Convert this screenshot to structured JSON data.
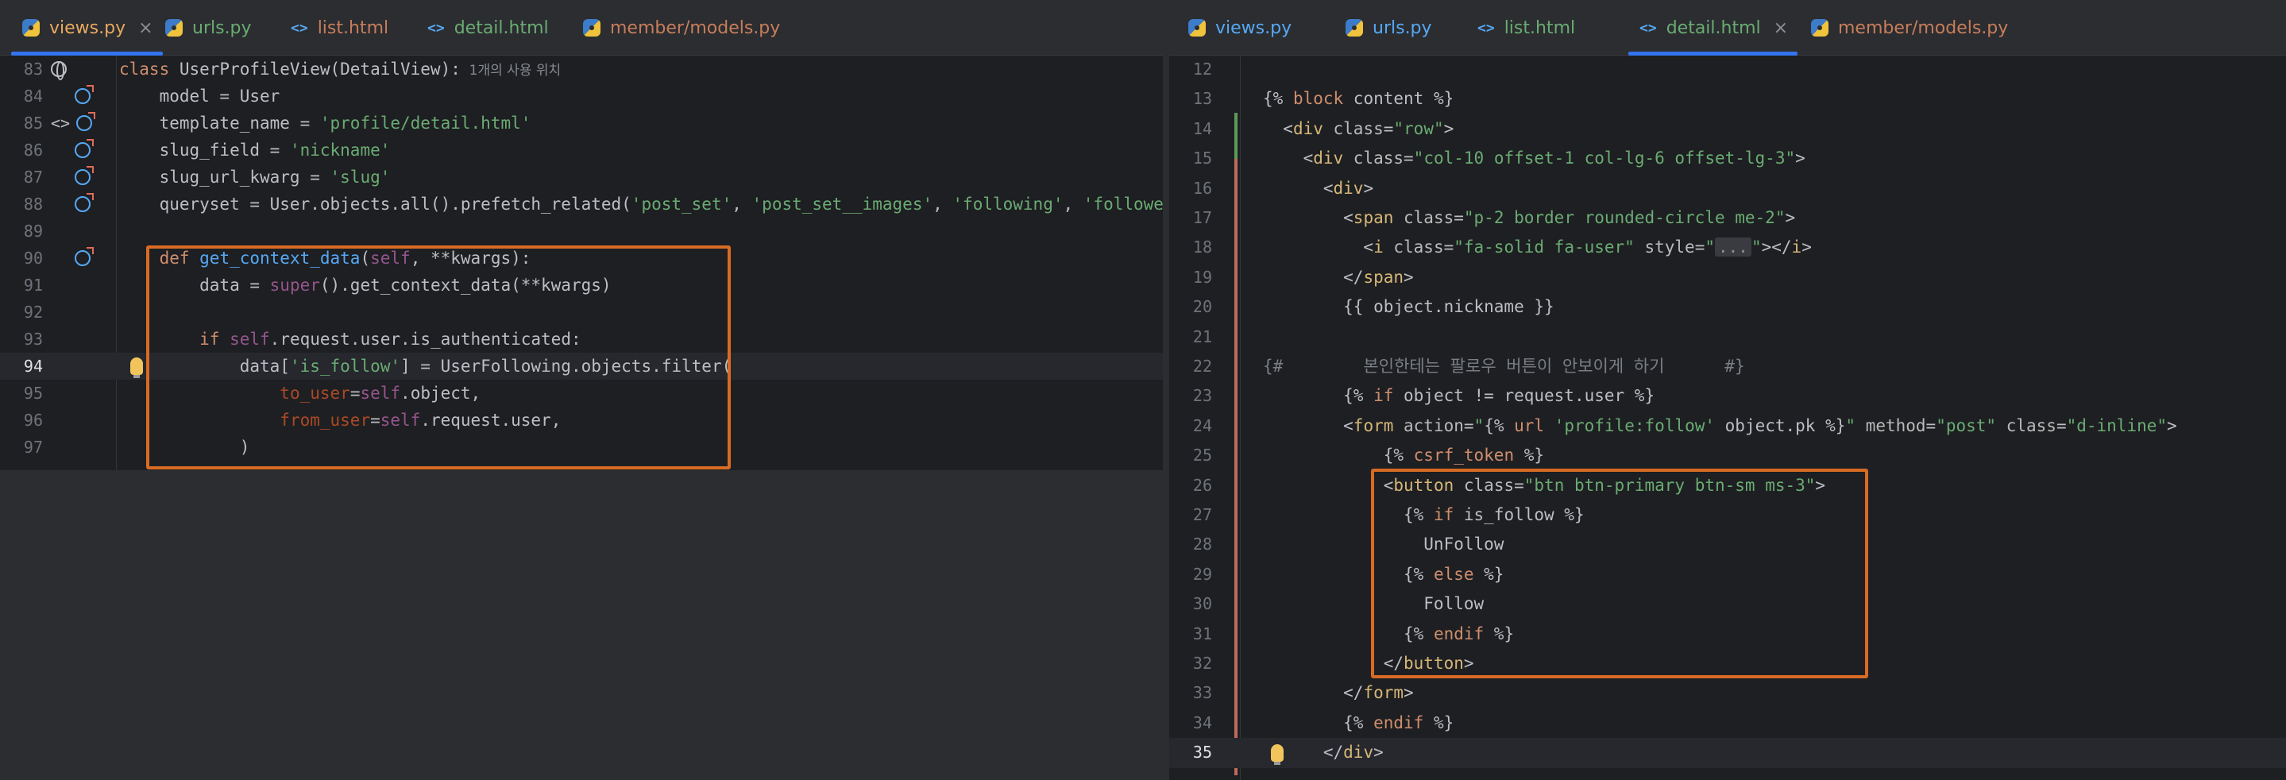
{
  "left_pane": {
    "tabs": [
      {
        "label": "views.py",
        "type": "python",
        "active": true,
        "closable": true,
        "color": "#e8a85f"
      },
      {
        "label": "urls.py",
        "type": "python",
        "active": false,
        "color": "#6aab73"
      },
      {
        "label": "list.html",
        "type": "html",
        "active": false,
        "color": "#c77d5b"
      },
      {
        "label": "detail.html",
        "type": "html",
        "active": false,
        "color": "#6aab73"
      },
      {
        "label": "member/models.py",
        "type": "python",
        "active": false,
        "color": "#c77d5b"
      }
    ],
    "usage_hint": "1개의 사용 위치",
    "code_lines": [
      {
        "no": "83",
        "segs": [
          [
            "kw",
            "class "
          ],
          [
            "plain",
            "UserProfileView(DetailView):"
          ]
        ]
      },
      {
        "no": "84",
        "segs": [
          [
            "plain",
            "    model = User"
          ]
        ]
      },
      {
        "no": "85",
        "segs": [
          [
            "plain",
            "    template_name = "
          ],
          [
            "str",
            "'profile/detail.html'"
          ]
        ]
      },
      {
        "no": "86",
        "segs": [
          [
            "plain",
            "    slug_field = "
          ],
          [
            "str",
            "'nickname'"
          ]
        ]
      },
      {
        "no": "87",
        "segs": [
          [
            "plain",
            "    slug_url_kwarg = "
          ],
          [
            "str",
            "'slug'"
          ]
        ]
      },
      {
        "no": "88",
        "segs": [
          [
            "plain",
            "    queryset = User.objects.all().prefetch_related("
          ],
          [
            "str",
            "'post_set'"
          ],
          [
            "plain",
            ", "
          ],
          [
            "str",
            "'post_set__images'"
          ],
          [
            "plain",
            ", "
          ],
          [
            "str",
            "'following'"
          ],
          [
            "plain",
            ", "
          ],
          [
            "str",
            "'followers'"
          ],
          [
            "plain",
            ")"
          ]
        ]
      },
      {
        "no": "89",
        "segs": []
      },
      {
        "no": "90",
        "segs": [
          [
            "plain",
            "    "
          ],
          [
            "kw",
            "def "
          ],
          [
            "fn",
            "get_context_data"
          ],
          [
            "plain",
            "("
          ],
          [
            "self",
            "self"
          ],
          [
            "plain",
            ", **kwargs):"
          ]
        ]
      },
      {
        "no": "91",
        "segs": [
          [
            "plain",
            "        data = "
          ],
          [
            "self",
            "super"
          ],
          [
            "plain",
            "().get_context_data(**kwargs)"
          ]
        ]
      },
      {
        "no": "92",
        "segs": []
      },
      {
        "no": "93",
        "segs": [
          [
            "plain",
            "        "
          ],
          [
            "kw",
            "if "
          ],
          [
            "self",
            "self"
          ],
          [
            "plain",
            ".request.user.is_authenticated:"
          ]
        ]
      },
      {
        "no": "94",
        "segs": [
          [
            "plain",
            "            data["
          ],
          [
            "str",
            "'is_follow'"
          ],
          [
            "plain",
            "] = UserFollowing.objects.filter("
          ]
        ]
      },
      {
        "no": "95",
        "segs": [
          [
            "plain",
            "                "
          ],
          [
            "arg",
            "to_user"
          ],
          [
            "plain",
            "="
          ],
          [
            "self",
            "self"
          ],
          [
            "plain",
            ".object,"
          ]
        ]
      },
      {
        "no": "96",
        "segs": [
          [
            "plain",
            "                "
          ],
          [
            "arg",
            "from_user"
          ],
          [
            "plain",
            "="
          ],
          [
            "self",
            "self"
          ],
          [
            "plain",
            ".request.user,"
          ]
        ]
      },
      {
        "no": "97",
        "segs": [
          [
            "plain",
            "            )"
          ]
        ]
      }
    ]
  },
  "right_pane": {
    "tabs": [
      {
        "label": "views.py",
        "type": "python",
        "active": false,
        "color": "#56a8f5"
      },
      {
        "label": "urls.py",
        "type": "python",
        "active": false,
        "color": "#56a8f5"
      },
      {
        "label": "list.html",
        "type": "html",
        "active": false,
        "color": "#6aab73"
      },
      {
        "label": "detail.html",
        "type": "html",
        "active": true,
        "closable": true,
        "color": "#6aab73"
      },
      {
        "label": "member/models.py",
        "type": "python",
        "active": false,
        "color": "#c77d5b"
      }
    ],
    "code_lines": [
      {
        "no": "12",
        "segs": []
      },
      {
        "no": "13",
        "segs": [
          [
            "plain",
            "{% "
          ],
          [
            "tpl",
            "block"
          ],
          [
            "plain",
            " content %}"
          ]
        ]
      },
      {
        "no": "14",
        "segs": [
          [
            "plain",
            "  <"
          ],
          [
            "tag",
            "div "
          ],
          [
            "attr",
            "class"
          ],
          [
            "plain",
            "="
          ],
          [
            "str",
            "\"row\""
          ],
          [
            "plain",
            ">"
          ]
        ]
      },
      {
        "no": "15",
        "segs": [
          [
            "plain",
            "    <"
          ],
          [
            "tag",
            "div "
          ],
          [
            "attr",
            "class"
          ],
          [
            "plain",
            "="
          ],
          [
            "str",
            "\"col-10 offset-1 col-lg-6 offset-lg-3\""
          ],
          [
            "plain",
            ">"
          ]
        ]
      },
      {
        "no": "16",
        "segs": [
          [
            "plain",
            "      <"
          ],
          [
            "tag",
            "div"
          ],
          [
            "plain",
            ">"
          ]
        ]
      },
      {
        "no": "17",
        "segs": [
          [
            "plain",
            "        <"
          ],
          [
            "tag",
            "span "
          ],
          [
            "attr",
            "class"
          ],
          [
            "plain",
            "="
          ],
          [
            "str",
            "\"p-2 border rounded-circle me-2\""
          ],
          [
            "plain",
            ">"
          ]
        ]
      },
      {
        "no": "18",
        "segs": [
          [
            "plain",
            "          <"
          ],
          [
            "tag",
            "i "
          ],
          [
            "attr",
            "class"
          ],
          [
            "plain",
            "="
          ],
          [
            "str",
            "\"fa-solid fa-user\" "
          ],
          [
            "attr",
            "style"
          ],
          [
            "plain",
            "="
          ],
          [
            "str",
            "\""
          ],
          [
            "fold",
            "..."
          ],
          [
            "str",
            "\""
          ],
          [
            "plain",
            "></"
          ],
          [
            "tag",
            "i"
          ],
          [
            "plain",
            ">"
          ]
        ]
      },
      {
        "no": "19",
        "segs": [
          [
            "plain",
            "        </"
          ],
          [
            "tag",
            "span"
          ],
          [
            "plain",
            ">"
          ]
        ]
      },
      {
        "no": "20",
        "segs": [
          [
            "plain",
            "        {{ object.nickname }}"
          ]
        ]
      },
      {
        "no": "21",
        "segs": []
      },
      {
        "no": "22",
        "segs": [
          [
            "cm",
            "{#        본인한테는 팔로우 버튼이 안보이게 하기      #}"
          ]
        ]
      },
      {
        "no": "23",
        "segs": [
          [
            "plain",
            "        {% "
          ],
          [
            "tpl",
            "if"
          ],
          [
            "plain",
            " object != request.user %}"
          ]
        ]
      },
      {
        "no": "24",
        "segs": [
          [
            "plain",
            "        <"
          ],
          [
            "tag",
            "form "
          ],
          [
            "attr",
            "action"
          ],
          [
            "plain",
            "="
          ],
          [
            "str",
            "\""
          ],
          [
            "plain",
            "{% "
          ],
          [
            "tpl",
            "url"
          ],
          [
            "plain",
            " "
          ],
          [
            "str",
            "'profile:follow'"
          ],
          [
            "plain",
            " object.pk %}"
          ],
          [
            "str",
            "\" "
          ],
          [
            "attr",
            "method"
          ],
          [
            "plain",
            "="
          ],
          [
            "str",
            "\"post\" "
          ],
          [
            "attr",
            "class"
          ],
          [
            "plain",
            "="
          ],
          [
            "str",
            "\"d-inline\""
          ],
          [
            "plain",
            ">"
          ]
        ]
      },
      {
        "no": "25",
        "segs": [
          [
            "plain",
            "            {% "
          ],
          [
            "tpl",
            "csrf_token"
          ],
          [
            "plain",
            " %}"
          ]
        ]
      },
      {
        "no": "26",
        "segs": [
          [
            "plain",
            "            <"
          ],
          [
            "tag",
            "button "
          ],
          [
            "attr",
            "class"
          ],
          [
            "plain",
            "="
          ],
          [
            "str",
            "\"btn btn-primary btn-sm ms-3\""
          ],
          [
            "plain",
            ">"
          ]
        ]
      },
      {
        "no": "27",
        "segs": [
          [
            "plain",
            "              {% "
          ],
          [
            "tpl",
            "if"
          ],
          [
            "plain",
            " is_follow %}"
          ]
        ]
      },
      {
        "no": "28",
        "segs": [
          [
            "plain",
            "                UnFollow"
          ]
        ]
      },
      {
        "no": "29",
        "segs": [
          [
            "plain",
            "              {% "
          ],
          [
            "tpl",
            "else"
          ],
          [
            "plain",
            " %}"
          ]
        ]
      },
      {
        "no": "30",
        "segs": [
          [
            "plain",
            "                Follow"
          ]
        ]
      },
      {
        "no": "31",
        "segs": [
          [
            "plain",
            "              {% "
          ],
          [
            "tpl",
            "endif"
          ],
          [
            "plain",
            " %}"
          ]
        ]
      },
      {
        "no": "32",
        "segs": [
          [
            "plain",
            "            </"
          ],
          [
            "tag",
            "button"
          ],
          [
            "plain",
            ">"
          ]
        ]
      },
      {
        "no": "33",
        "segs": [
          [
            "plain",
            "        </"
          ],
          [
            "tag",
            "form"
          ],
          [
            "plain",
            ">"
          ]
        ]
      },
      {
        "no": "34",
        "segs": [
          [
            "plain",
            "        {% "
          ],
          [
            "tpl",
            "endif"
          ],
          [
            "plain",
            " %}"
          ]
        ]
      },
      {
        "no": "35",
        "segs": [
          [
            "plain",
            "      </"
          ],
          [
            "tag",
            "div"
          ],
          [
            "plain",
            ">"
          ]
        ]
      }
    ]
  }
}
